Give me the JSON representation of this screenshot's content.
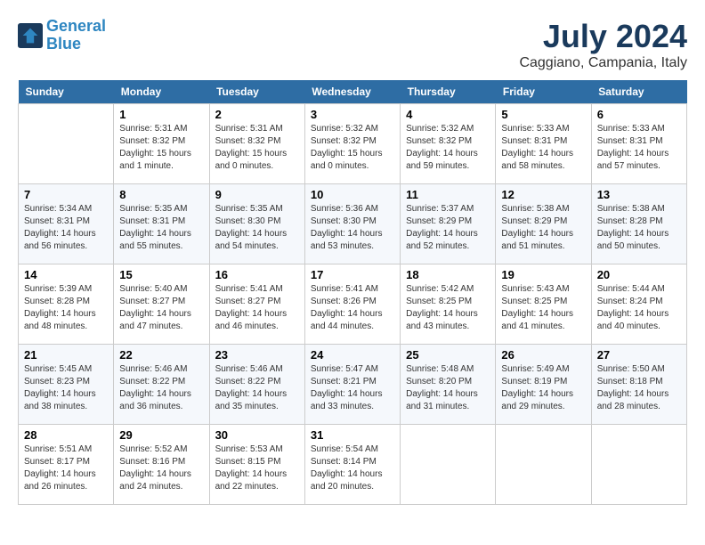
{
  "logo": {
    "line1": "General",
    "line2": "Blue"
  },
  "title": "July 2024",
  "location": "Caggiano, Campania, Italy",
  "weekdays": [
    "Sunday",
    "Monday",
    "Tuesday",
    "Wednesday",
    "Thursday",
    "Friday",
    "Saturday"
  ],
  "weeks": [
    [
      {
        "day": "",
        "info": ""
      },
      {
        "day": "1",
        "info": "Sunrise: 5:31 AM\nSunset: 8:32 PM\nDaylight: 15 hours\nand 1 minute."
      },
      {
        "day": "2",
        "info": "Sunrise: 5:31 AM\nSunset: 8:32 PM\nDaylight: 15 hours\nand 0 minutes."
      },
      {
        "day": "3",
        "info": "Sunrise: 5:32 AM\nSunset: 8:32 PM\nDaylight: 15 hours\nand 0 minutes."
      },
      {
        "day": "4",
        "info": "Sunrise: 5:32 AM\nSunset: 8:32 PM\nDaylight: 14 hours\nand 59 minutes."
      },
      {
        "day": "5",
        "info": "Sunrise: 5:33 AM\nSunset: 8:31 PM\nDaylight: 14 hours\nand 58 minutes."
      },
      {
        "day": "6",
        "info": "Sunrise: 5:33 AM\nSunset: 8:31 PM\nDaylight: 14 hours\nand 57 minutes."
      }
    ],
    [
      {
        "day": "7",
        "info": "Sunrise: 5:34 AM\nSunset: 8:31 PM\nDaylight: 14 hours\nand 56 minutes."
      },
      {
        "day": "8",
        "info": "Sunrise: 5:35 AM\nSunset: 8:31 PM\nDaylight: 14 hours\nand 55 minutes."
      },
      {
        "day": "9",
        "info": "Sunrise: 5:35 AM\nSunset: 8:30 PM\nDaylight: 14 hours\nand 54 minutes."
      },
      {
        "day": "10",
        "info": "Sunrise: 5:36 AM\nSunset: 8:30 PM\nDaylight: 14 hours\nand 53 minutes."
      },
      {
        "day": "11",
        "info": "Sunrise: 5:37 AM\nSunset: 8:29 PM\nDaylight: 14 hours\nand 52 minutes."
      },
      {
        "day": "12",
        "info": "Sunrise: 5:38 AM\nSunset: 8:29 PM\nDaylight: 14 hours\nand 51 minutes."
      },
      {
        "day": "13",
        "info": "Sunrise: 5:38 AM\nSunset: 8:28 PM\nDaylight: 14 hours\nand 50 minutes."
      }
    ],
    [
      {
        "day": "14",
        "info": "Sunrise: 5:39 AM\nSunset: 8:28 PM\nDaylight: 14 hours\nand 48 minutes."
      },
      {
        "day": "15",
        "info": "Sunrise: 5:40 AM\nSunset: 8:27 PM\nDaylight: 14 hours\nand 47 minutes."
      },
      {
        "day": "16",
        "info": "Sunrise: 5:41 AM\nSunset: 8:27 PM\nDaylight: 14 hours\nand 46 minutes."
      },
      {
        "day": "17",
        "info": "Sunrise: 5:41 AM\nSunset: 8:26 PM\nDaylight: 14 hours\nand 44 minutes."
      },
      {
        "day": "18",
        "info": "Sunrise: 5:42 AM\nSunset: 8:25 PM\nDaylight: 14 hours\nand 43 minutes."
      },
      {
        "day": "19",
        "info": "Sunrise: 5:43 AM\nSunset: 8:25 PM\nDaylight: 14 hours\nand 41 minutes."
      },
      {
        "day": "20",
        "info": "Sunrise: 5:44 AM\nSunset: 8:24 PM\nDaylight: 14 hours\nand 40 minutes."
      }
    ],
    [
      {
        "day": "21",
        "info": "Sunrise: 5:45 AM\nSunset: 8:23 PM\nDaylight: 14 hours\nand 38 minutes."
      },
      {
        "day": "22",
        "info": "Sunrise: 5:46 AM\nSunset: 8:22 PM\nDaylight: 14 hours\nand 36 minutes."
      },
      {
        "day": "23",
        "info": "Sunrise: 5:46 AM\nSunset: 8:22 PM\nDaylight: 14 hours\nand 35 minutes."
      },
      {
        "day": "24",
        "info": "Sunrise: 5:47 AM\nSunset: 8:21 PM\nDaylight: 14 hours\nand 33 minutes."
      },
      {
        "day": "25",
        "info": "Sunrise: 5:48 AM\nSunset: 8:20 PM\nDaylight: 14 hours\nand 31 minutes."
      },
      {
        "day": "26",
        "info": "Sunrise: 5:49 AM\nSunset: 8:19 PM\nDaylight: 14 hours\nand 29 minutes."
      },
      {
        "day": "27",
        "info": "Sunrise: 5:50 AM\nSunset: 8:18 PM\nDaylight: 14 hours\nand 28 minutes."
      }
    ],
    [
      {
        "day": "28",
        "info": "Sunrise: 5:51 AM\nSunset: 8:17 PM\nDaylight: 14 hours\nand 26 minutes."
      },
      {
        "day": "29",
        "info": "Sunrise: 5:52 AM\nSunset: 8:16 PM\nDaylight: 14 hours\nand 24 minutes."
      },
      {
        "day": "30",
        "info": "Sunrise: 5:53 AM\nSunset: 8:15 PM\nDaylight: 14 hours\nand 22 minutes."
      },
      {
        "day": "31",
        "info": "Sunrise: 5:54 AM\nSunset: 8:14 PM\nDaylight: 14 hours\nand 20 minutes."
      },
      {
        "day": "",
        "info": ""
      },
      {
        "day": "",
        "info": ""
      },
      {
        "day": "",
        "info": ""
      }
    ]
  ]
}
